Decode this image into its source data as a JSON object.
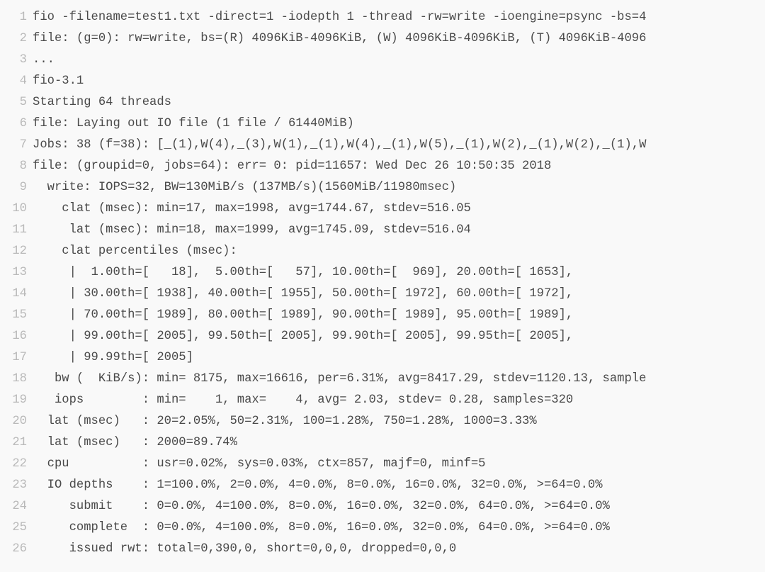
{
  "lines": [
    {
      "n": 1,
      "text": "fio -filename=test1.txt -direct=1 -iodepth 1 -thread -rw=write -ioengine=psync -bs=4"
    },
    {
      "n": 2,
      "text": "file: (g=0): rw=write, bs=(R) 4096KiB-4096KiB, (W) 4096KiB-4096KiB, (T) 4096KiB-4096"
    },
    {
      "n": 3,
      "text": "..."
    },
    {
      "n": 4,
      "text": "fio-3.1"
    },
    {
      "n": 5,
      "text": "Starting 64 threads"
    },
    {
      "n": 6,
      "text": "file: Laying out IO file (1 file / 61440MiB)"
    },
    {
      "n": 7,
      "text": "Jobs: 38 (f=38): [_(1),W(4),_(3),W(1),_(1),W(4),_(1),W(5),_(1),W(2),_(1),W(2),_(1),W"
    },
    {
      "n": 8,
      "text": "file: (groupid=0, jobs=64): err= 0: pid=11657: Wed Dec 26 10:50:35 2018"
    },
    {
      "n": 9,
      "text": "  write: IOPS=32, BW=130MiB/s (137MB/s)(1560MiB/11980msec)"
    },
    {
      "n": 10,
      "text": "    clat (msec): min=17, max=1998, avg=1744.67, stdev=516.05"
    },
    {
      "n": 11,
      "text": "     lat (msec): min=18, max=1999, avg=1745.09, stdev=516.04"
    },
    {
      "n": 12,
      "text": "    clat percentiles (msec):"
    },
    {
      "n": 13,
      "text": "     |  1.00th=[   18],  5.00th=[   57], 10.00th=[  969], 20.00th=[ 1653],"
    },
    {
      "n": 14,
      "text": "     | 30.00th=[ 1938], 40.00th=[ 1955], 50.00th=[ 1972], 60.00th=[ 1972],"
    },
    {
      "n": 15,
      "text": "     | 70.00th=[ 1989], 80.00th=[ 1989], 90.00th=[ 1989], 95.00th=[ 1989],"
    },
    {
      "n": 16,
      "text": "     | 99.00th=[ 2005], 99.50th=[ 2005], 99.90th=[ 2005], 99.95th=[ 2005],"
    },
    {
      "n": 17,
      "text": "     | 99.99th=[ 2005]"
    },
    {
      "n": 18,
      "text": "   bw (  KiB/s): min= 8175, max=16616, per=6.31%, avg=8417.29, stdev=1120.13, sample"
    },
    {
      "n": 19,
      "text": "   iops        : min=    1, max=    4, avg= 2.03, stdev= 0.28, samples=320"
    },
    {
      "n": 20,
      "text": "  lat (msec)   : 20=2.05%, 50=2.31%, 100=1.28%, 750=1.28%, 1000=3.33%"
    },
    {
      "n": 21,
      "text": "  lat (msec)   : 2000=89.74%"
    },
    {
      "n": 22,
      "text": "  cpu          : usr=0.02%, sys=0.03%, ctx=857, majf=0, minf=5"
    },
    {
      "n": 23,
      "text": "  IO depths    : 1=100.0%, 2=0.0%, 4=0.0%, 8=0.0%, 16=0.0%, 32=0.0%, >=64=0.0%"
    },
    {
      "n": 24,
      "text": "     submit    : 0=0.0%, 4=100.0%, 8=0.0%, 16=0.0%, 32=0.0%, 64=0.0%, >=64=0.0%"
    },
    {
      "n": 25,
      "text": "     complete  : 0=0.0%, 4=100.0%, 8=0.0%, 16=0.0%, 32=0.0%, 64=0.0%, >=64=0.0%"
    },
    {
      "n": 26,
      "text": "     issued rwt: total=0,390,0, short=0,0,0, dropped=0,0,0"
    }
  ]
}
